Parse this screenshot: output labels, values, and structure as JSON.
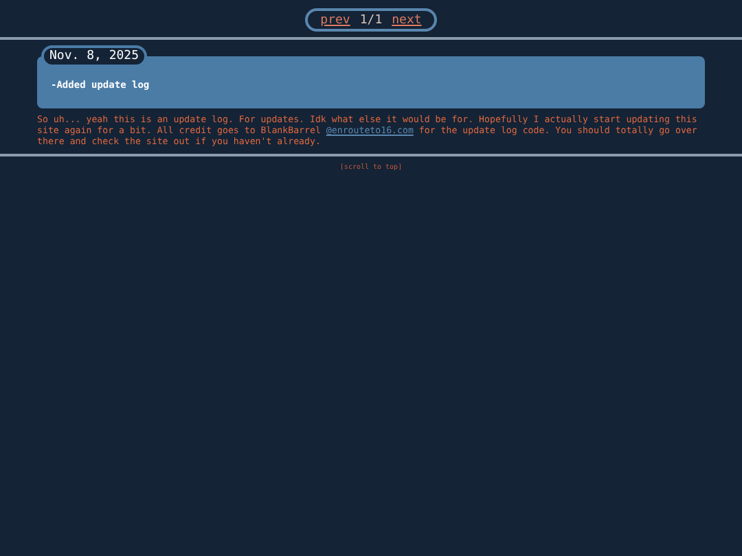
{
  "pager": {
    "prev": "prev",
    "page": "1/1",
    "next": "next"
  },
  "entries": [
    {
      "date": "Nov. 8, 2025",
      "text": "-Added update log"
    }
  ],
  "note": {
    "before": "So uh... yeah this is an update log. For updates. Idk what else it would be for. Hopefully I actually start updating this site again for a bit. All credit goes to BlankBarrel ",
    "link": "@enrouteto16.com",
    "after": " for the update log code. You should totally go over there and check the site out if you haven't already."
  },
  "scroll_top": "[scroll to top]"
}
